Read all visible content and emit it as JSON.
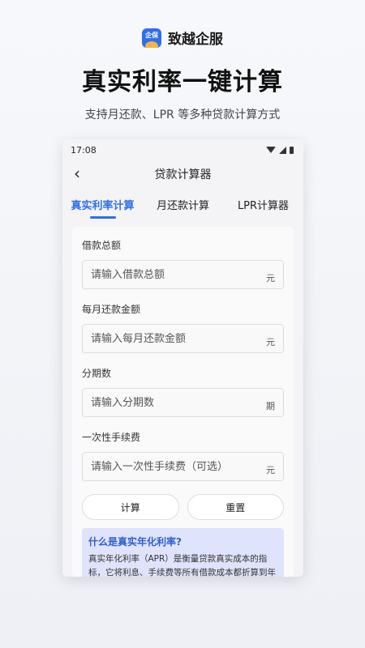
{
  "brand": {
    "logo_tag": "企保",
    "name": "致越企服"
  },
  "headline": "真实利率一键计算",
  "subline": "支持月还款、LPR 等多种贷款计算方式",
  "status": {
    "time": "17:08"
  },
  "appbar": {
    "title": "贷款计算器"
  },
  "tabs": [
    {
      "label": "真实利率计算"
    },
    {
      "label": "月还款计算"
    },
    {
      "label": "LPR计算器"
    }
  ],
  "form": {
    "fields": [
      {
        "label": "借款总额",
        "placeholder": "请输入借款总额",
        "unit": "元"
      },
      {
        "label": "每月还款金额",
        "placeholder": "请输入每月还款金额",
        "unit": "元"
      },
      {
        "label": "分期数",
        "placeholder": "请输入分期数",
        "unit": "期"
      },
      {
        "label": "一次性手续费",
        "placeholder": "请输入一次性手续费（可选）",
        "unit": "元"
      }
    ],
    "calc_label": "计算",
    "reset_label": "重置"
  },
  "info": {
    "title": "什么是真实年化利率?",
    "text": "真实年化利率（APR）是衡量贷款真实成本的指标，它将利息、手续费等所有借款成本都折算到年度利率中，能更准确地反映你为贷款支付的实际成本。"
  },
  "colors": {
    "accent": "#2f6fea",
    "info_bg": "#dfe3fb"
  }
}
